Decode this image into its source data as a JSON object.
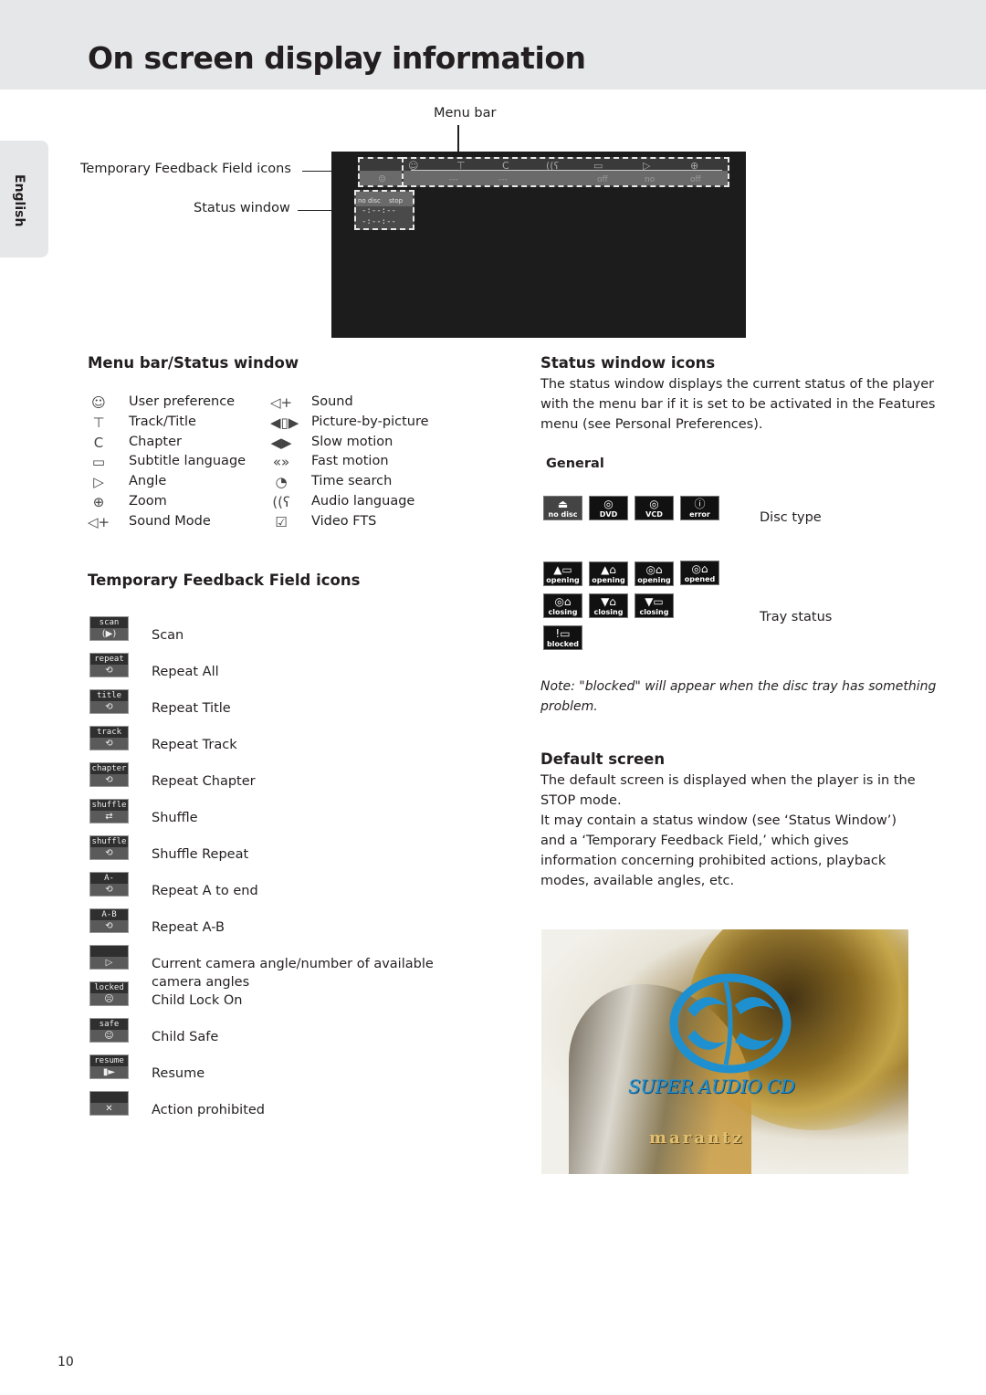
{
  "page": {
    "title": "On screen display information",
    "language_tab": "English",
    "page_number": "10"
  },
  "diagram": {
    "menu_bar_label": "Menu bar",
    "tf_label": "Temporary Feedback Field icons",
    "status_label": "Status window",
    "menubar_icons": [
      "user-preference",
      "track-title",
      "chapter",
      "audio-language",
      "subtitle-language",
      "angle",
      "zoom"
    ],
    "menubar_values": [
      "---",
      "---",
      "",
      "off",
      "no",
      "off"
    ],
    "status_window": {
      "disc": "no disc",
      "mode": "stop",
      "time1": "-:--:--",
      "time2": "-:--:--"
    }
  },
  "menu_status": {
    "heading": "Menu bar/Status window",
    "left": [
      {
        "icon": "user-preference-icon",
        "glyph": "☺",
        "label": "User preference"
      },
      {
        "icon": "track-title-icon",
        "glyph": "⊤",
        "label": "Track/Title"
      },
      {
        "icon": "chapter-icon",
        "glyph": "C",
        "label": "Chapter"
      },
      {
        "icon": "subtitle-language-icon",
        "glyph": "▭",
        "label": "Subtitle language"
      },
      {
        "icon": "angle-icon",
        "glyph": "▷",
        "label": "Angle"
      },
      {
        "icon": "zoom-icon",
        "glyph": "⊕",
        "label": "Zoom"
      },
      {
        "icon": "sound-mode-icon",
        "glyph": "◁+",
        "label": "Sound Mode"
      }
    ],
    "right": [
      {
        "icon": "sound-icon",
        "glyph": "◁+",
        "label": "Sound"
      },
      {
        "icon": "picture-by-picture-icon",
        "glyph": "◀▯▶",
        "label": "Picture-by-picture"
      },
      {
        "icon": "slow-motion-icon",
        "glyph": "◀▶",
        "label": "Slow motion"
      },
      {
        "icon": "fast-motion-icon",
        "glyph": "«»",
        "label": "Fast motion"
      },
      {
        "icon": "time-search-icon",
        "glyph": "◔",
        "label": "Time search"
      },
      {
        "icon": "audio-language-icon",
        "glyph": "((ʕ",
        "label": "Audio language"
      },
      {
        "icon": "video-fts-icon",
        "glyph": "☑",
        "label": "Video FTS"
      }
    ]
  },
  "temp_feedback": {
    "heading": "Temporary Feedback Field icons",
    "items": [
      {
        "tag": "scan",
        "glyph": "(▶)",
        "label": "Scan"
      },
      {
        "tag": "repeat",
        "glyph": "⟲",
        "label": "Repeat All"
      },
      {
        "tag": "title",
        "glyph": "⟲",
        "label": "Repeat Title"
      },
      {
        "tag": "track",
        "glyph": "⟲",
        "label": "Repeat Track"
      },
      {
        "tag": "chapter",
        "glyph": "⟲",
        "label": "Repeat Chapter"
      },
      {
        "tag": "shuffle",
        "glyph": "⇄",
        "label": "Shuffle"
      },
      {
        "tag": "shuffle",
        "glyph": "⟲",
        "label": "Shuffle Repeat"
      },
      {
        "tag": "A-",
        "glyph": "⟲",
        "label": "Repeat A to end"
      },
      {
        "tag": "A-B",
        "glyph": "⟲",
        "label": "Repeat A-B"
      },
      {
        "tag": "",
        "glyph": "▷",
        "label": "Current camera angle/number of available camera angles"
      },
      {
        "tag": "locked",
        "glyph": "☹",
        "label": "Child Lock On"
      },
      {
        "tag": "safe",
        "glyph": "☺",
        "label": "Child Safe"
      },
      {
        "tag": "resume",
        "glyph": "▮►",
        "label": "Resume"
      },
      {
        "tag": "",
        "glyph": "✕",
        "label": "Action prohibited"
      }
    ]
  },
  "status_icons": {
    "heading": "Status window icons",
    "intro": "The status window displays the current status of the player with the menu bar if it is set to be activated in the Features menu (see Personal Preferences).",
    "general_heading": "General",
    "disc_type_label": "Disc type",
    "disc_types": [
      {
        "glyph": "⏏",
        "text": "no disc"
      },
      {
        "glyph": "◎",
        "text": "DVD"
      },
      {
        "glyph": "◎",
        "text": "VCD"
      },
      {
        "glyph": "ⓘ",
        "text": "error"
      }
    ],
    "tray_status_label": "Tray status",
    "tray_states": [
      {
        "glyph": "▲▭",
        "text": "opening"
      },
      {
        "glyph": "▲⌂",
        "text": "opening"
      },
      {
        "glyph": "◎⌂",
        "text": "opening"
      },
      {
        "glyph": "◎⌂",
        "text": "opened"
      },
      {
        "glyph": "◎⌂",
        "text": "closing"
      },
      {
        "glyph": "▼⌂",
        "text": "closing"
      },
      {
        "glyph": "▼▭",
        "text": "closing"
      },
      {
        "glyph": "!▭",
        "text": "blocked"
      }
    ],
    "note": "Note: \"blocked\" will appear when the disc tray has something problem."
  },
  "default_screen": {
    "heading": "Default screen",
    "para1": "The default screen is displayed when the player is in the STOP mode.",
    "para2": "It may contain a status window (see ‘Status Window’) and a ‘Temporary Feedback Field,’ which gives information concerning prohibited actions, playback modes, available angles, etc.",
    "image_title": "SUPER AUDIO CD",
    "image_brand": "marantz"
  }
}
